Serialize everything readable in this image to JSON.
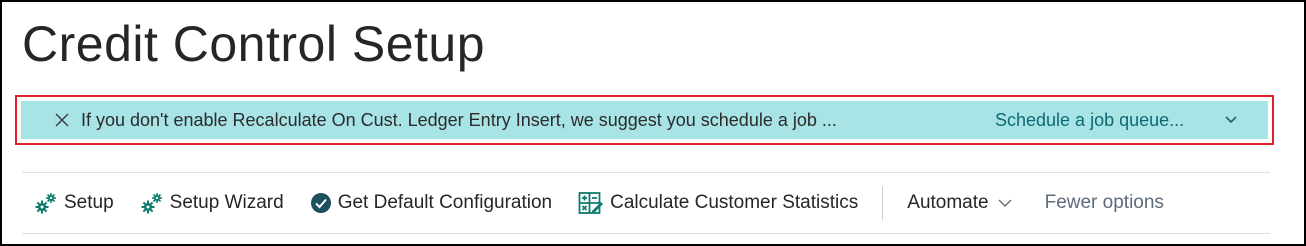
{
  "page": {
    "title": "Credit Control Setup"
  },
  "banner": {
    "message": "If you don't enable Recalculate On Cust. Ledger Entry Insert, we suggest you schedule a job ...",
    "action_label": "Schedule a job queue...",
    "background_color": "#a8e4e6",
    "highlight_border_color": "#e0202a"
  },
  "actions": {
    "setup_label": "Setup",
    "setup_wizard_label": "Setup Wizard",
    "get_default_configuration_label": "Get Default Configuration",
    "calculate_customer_statistics_label": "Calculate Customer Statistics",
    "automate_label": "Automate",
    "fewer_options_label": "Fewer options"
  },
  "icons": {
    "setup": "gears-icon",
    "setup_wizard": "gears-icon",
    "get_default_configuration": "check-circle-icon",
    "calculate_customer_statistics": "calculate-icon",
    "automate_chevron": "chevron-down-icon",
    "banner_close": "close-icon",
    "banner_expand": "chevron-down-icon"
  },
  "colors": {
    "accent": "#0b6a73",
    "icon_teal": "#0e7b6f",
    "check_dark": "#1d4f5e"
  }
}
